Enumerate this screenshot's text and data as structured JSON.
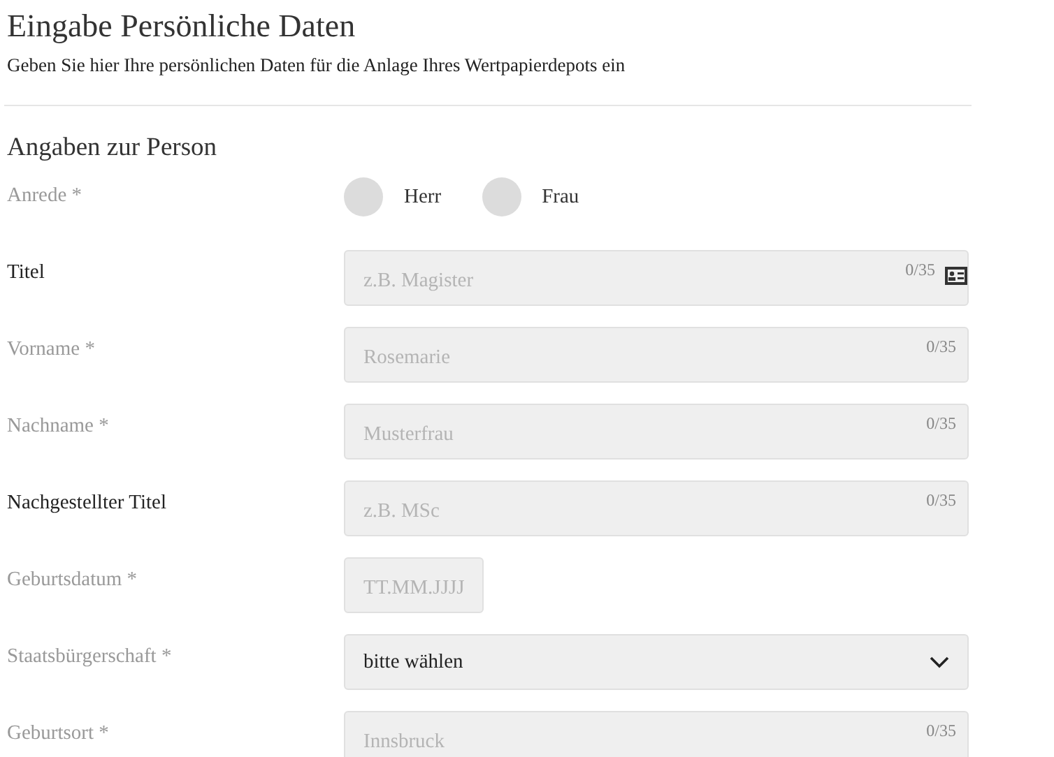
{
  "header": {
    "title": "Eingabe Persönliche Daten",
    "subtitle": "Geben Sie hier Ihre persönlichen Daten für die Anlage Ihres Wertpapierdepots ein"
  },
  "section": {
    "title": "Angaben zur Person"
  },
  "fields": [
    {
      "kind": "radio",
      "label": "Anrede *",
      "required": true,
      "options": [
        {
          "label": "Herr",
          "selected": false
        },
        {
          "label": "Frau",
          "selected": false
        }
      ]
    },
    {
      "kind": "text",
      "label": "Titel",
      "required": false,
      "placeholder": "z.B. Magister",
      "counter": "0/35",
      "autofill": true
    },
    {
      "kind": "text",
      "label": "Vorname *",
      "required": true,
      "placeholder": "Rosemarie",
      "counter": "0/35"
    },
    {
      "kind": "text",
      "label": "Nachname *",
      "required": true,
      "placeholder": "Musterfrau",
      "counter": "0/35"
    },
    {
      "kind": "text",
      "label": "Nachgestellter Titel",
      "required": false,
      "placeholder": "z.B. MSc",
      "counter": "0/35"
    },
    {
      "kind": "date",
      "label": "Geburtsdatum *",
      "required": true,
      "placeholder": "TT.MM.JJJJ"
    },
    {
      "kind": "select",
      "label": "Staatsbürgerschaft *",
      "required": true,
      "value": "bitte wählen"
    },
    {
      "kind": "text",
      "label": "Geburtsort *",
      "required": true,
      "placeholder": "Innsbruck",
      "counter": "0/35"
    }
  ]
}
